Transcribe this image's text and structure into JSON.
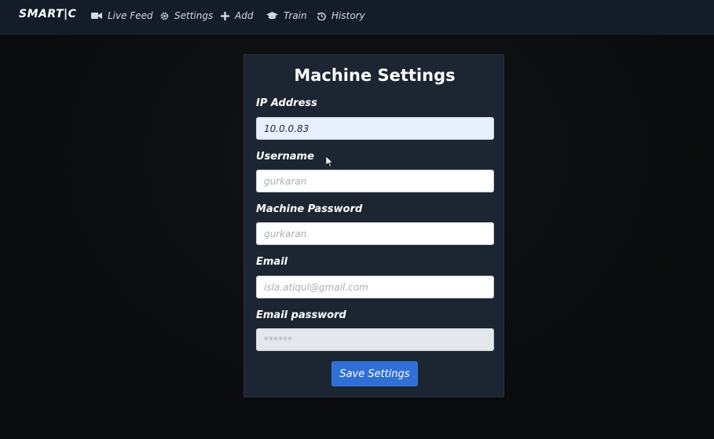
{
  "nav": {
    "brand": "SMART|C",
    "items": [
      {
        "label": "Live Feed",
        "icon": "video-camera-icon"
      },
      {
        "label": "Settings",
        "icon": "gear-icon"
      },
      {
        "label": "Add",
        "icon": "plus-icon"
      },
      {
        "label": "Train",
        "icon": "graduation-cap-icon"
      },
      {
        "label": "History",
        "icon": "history-icon"
      }
    ]
  },
  "form": {
    "title": "Machine Settings",
    "fields": [
      {
        "label": "IP Address",
        "value": "10.0.0.83",
        "placeholder": ""
      },
      {
        "label": "Username",
        "value": "",
        "placeholder": "gurkaran"
      },
      {
        "label": "Machine Password",
        "value": "",
        "placeholder": "gurkaran"
      },
      {
        "label": "Email",
        "value": "",
        "placeholder": "isla.atiqul@gmail.com"
      },
      {
        "label": "Email password",
        "value": "",
        "placeholder": "******"
      }
    ],
    "save_label": "Save Settings"
  },
  "colors": {
    "navbar_bg": "#141c29",
    "card_bg": "#1c2532",
    "button_bg": "#2f6fd6",
    "page_bg": "#0b0c0e"
  }
}
